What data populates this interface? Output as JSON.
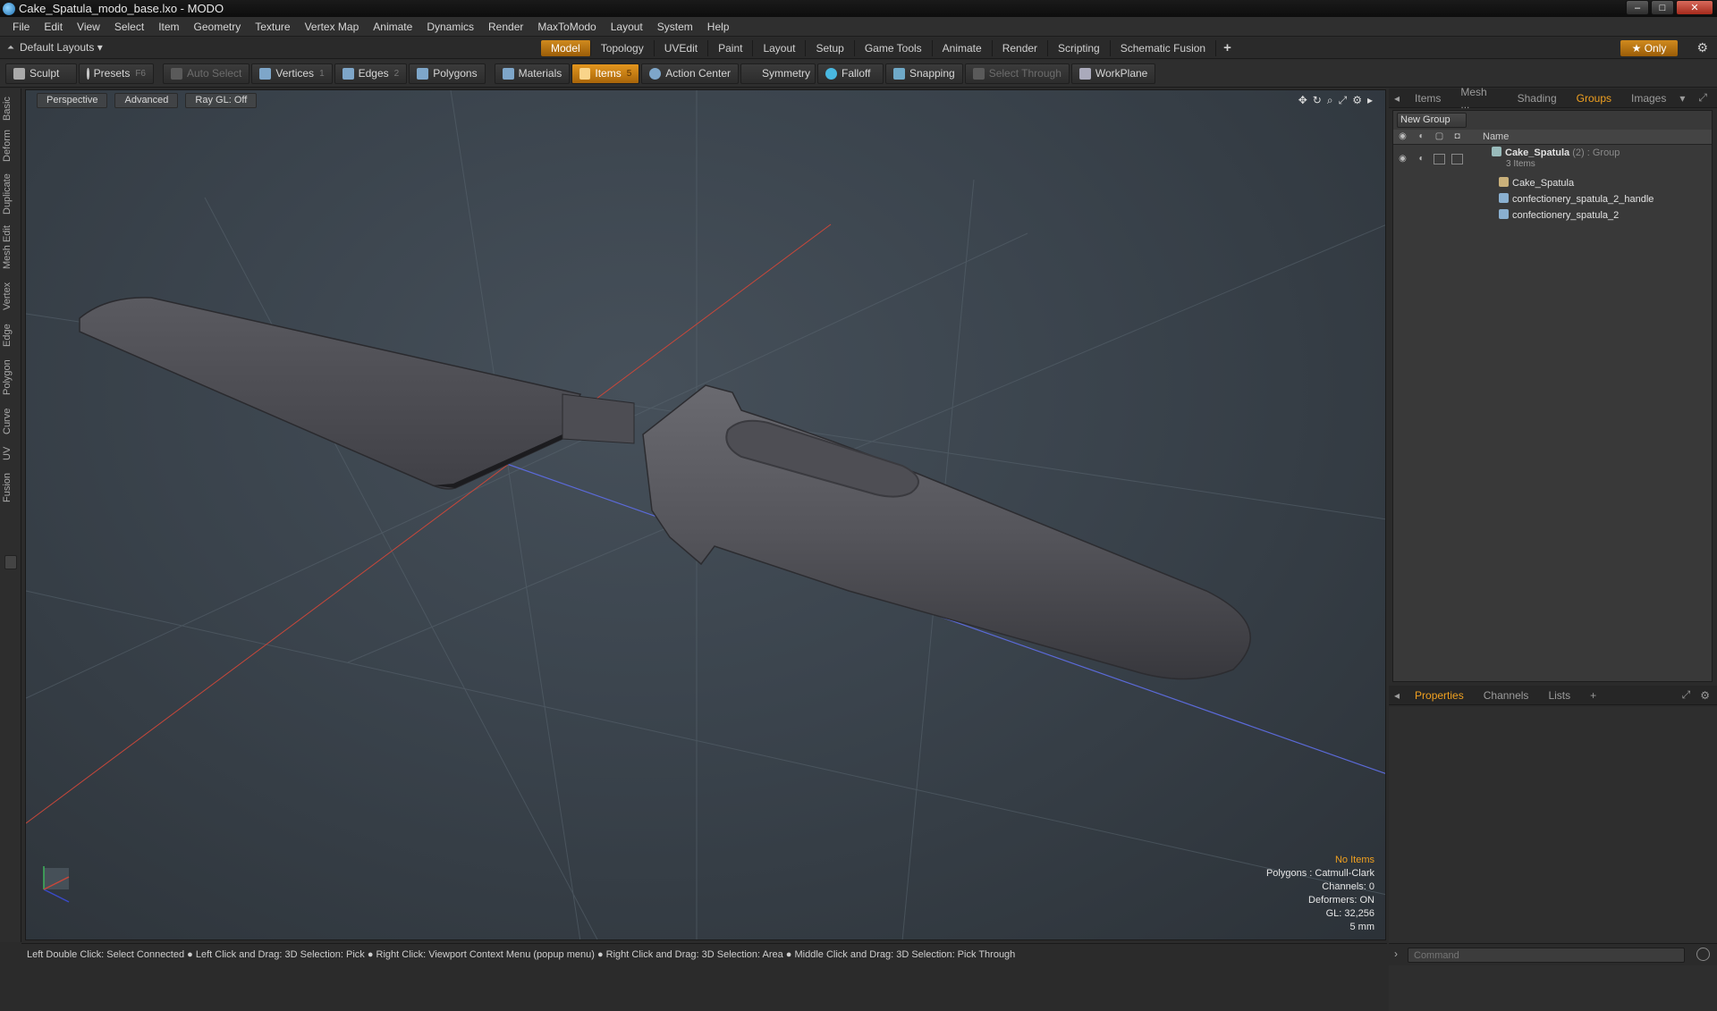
{
  "window": {
    "title": "Cake_Spatula_modo_base.lxo - MODO",
    "minimize": "–",
    "maximize": "□",
    "close": "✕"
  },
  "menu": [
    "File",
    "Edit",
    "View",
    "Select",
    "Item",
    "Geometry",
    "Texture",
    "Vertex Map",
    "Animate",
    "Dynamics",
    "Render",
    "MaxToModo",
    "Layout",
    "System",
    "Help"
  ],
  "layout": {
    "selector": "Default Layouts ▾",
    "tabs": [
      "Model",
      "Topology",
      "UVEdit",
      "Paint",
      "Layout",
      "Setup",
      "Game Tools",
      "Animate",
      "Render",
      "Scripting",
      "Schematic Fusion"
    ],
    "active_tab": "Model",
    "add": "+",
    "only": "★  Only"
  },
  "toolbar": {
    "sculpt": "Sculpt",
    "presets": "Presets",
    "presets_key": "F6",
    "auto_select": "Auto Select",
    "vertices": "Vertices",
    "vertices_key": "1",
    "edges": "Edges",
    "edges_key": "2",
    "polygons": "Polygons",
    "materials": "Materials",
    "items": "Items",
    "items_key": "5",
    "action_center": "Action Center",
    "symmetry": "Symmetry",
    "falloff": "Falloff",
    "snapping": "Snapping",
    "select_through": "Select Through",
    "workplane": "WorkPlane"
  },
  "left_tabs": [
    "Basic",
    "Deform",
    "Duplicate",
    "Mesh Edit",
    "Vertex",
    "Edge",
    "Polygon",
    "Curve",
    "UV",
    "Fusion"
  ],
  "viewport": {
    "perspective": "Perspective",
    "advanced": "Advanced",
    "raygl": "Ray GL: Off",
    "info": {
      "no_items": "No Items",
      "polygons": "Polygons : Catmull-Clark",
      "channels": "Channels: 0",
      "deformers": "Deformers: ON",
      "gl": "GL: 32,256",
      "scale": "5 mm"
    }
  },
  "panel_top": {
    "tabs": [
      "Items",
      "Mesh ...",
      "Shading",
      "Groups",
      "Images"
    ],
    "active": "Groups",
    "new_group": "New Group",
    "col_name": "Name",
    "group": {
      "name": "Cake_Spatula",
      "count": "(2)",
      "type": ": Group",
      "sub": "3 Items"
    },
    "children": [
      "Cake_Spatula",
      "confectionery_spatula_2_handle",
      "confectionery_spatula_2"
    ]
  },
  "panel_bottom": {
    "tabs": [
      "Properties",
      "Channels",
      "Lists",
      "+"
    ],
    "active": "Properties"
  },
  "status": "Left Double Click: Select Connected ● Left Click and Drag: 3D Selection: Pick ● Right Click: Viewport Context Menu (popup menu) ● Right Click and Drag: 3D Selection: Area ● Middle Click and Drag: 3D Selection: Pick Through",
  "command": {
    "placeholder": "Command"
  }
}
